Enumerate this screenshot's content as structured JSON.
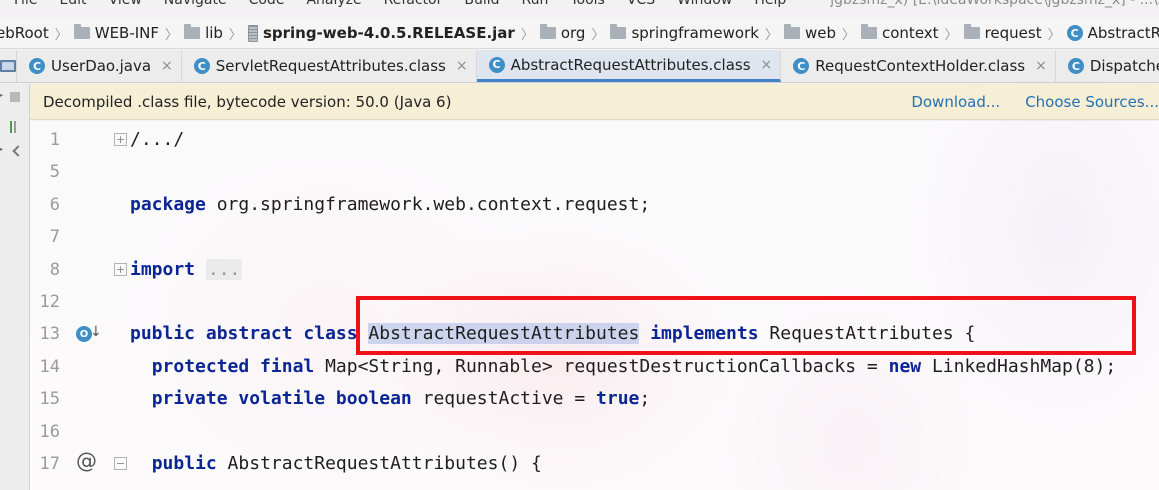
{
  "menubar": {
    "items": [
      "File",
      "Edit",
      "View",
      "Navigate",
      "Code",
      "Analyze",
      "Refactor",
      "Build",
      "Run",
      "Tools",
      "VCS",
      "Window",
      "Help"
    ],
    "project_path": "jgbzsmz_x) [E:\\ideaWorkspace\\jgbzsmz_x] - ...\\spring"
  },
  "breadcrumbs": [
    {
      "label": "ebRoot",
      "icon": "folder-icon",
      "bold": false
    },
    {
      "label": "WEB-INF",
      "icon": "folder-icon",
      "bold": false
    },
    {
      "label": "lib",
      "icon": "folder-icon",
      "bold": false
    },
    {
      "label": "spring-web-4.0.5.RELEASE.jar",
      "icon": "jar-icon",
      "bold": true
    },
    {
      "label": "org",
      "icon": "folder-icon",
      "bold": false
    },
    {
      "label": "springframework",
      "icon": "folder-icon",
      "bold": false
    },
    {
      "label": "web",
      "icon": "folder-icon",
      "bold": false
    },
    {
      "label": "context",
      "icon": "folder-icon",
      "bold": false
    },
    {
      "label": "request",
      "icon": "folder-icon",
      "bold": false
    },
    {
      "label": "AbstractRequestAttributes",
      "icon": "class-icon",
      "bold": false
    }
  ],
  "tabs": [
    {
      "label": "UserDao.java",
      "active": false
    },
    {
      "label": "ServletRequestAttributes.class",
      "active": false
    },
    {
      "label": "AbstractRequestAttributes.class",
      "active": true
    },
    {
      "label": "RequestContextHolder.class",
      "active": false
    },
    {
      "label": "Dispatcher",
      "active": false
    }
  ],
  "tab_close_glyph": "×",
  "class_icon_letter": "C",
  "banner": {
    "text": "Decompiled .class file, bytecode version: 50.0 (Java 6)",
    "download_label": "Download...",
    "sources_label": "Choose Sources..."
  },
  "code": {
    "lines": [
      {
        "num": "1",
        "text": "/.../",
        "kind": "fold-comment"
      },
      {
        "num": "5",
        "text": "",
        "kind": "plain"
      },
      {
        "num": "6",
        "kw": "package",
        "text": " org.springframework.web.context.request;",
        "kind": "package"
      },
      {
        "num": "7",
        "text": "",
        "kind": "plain"
      },
      {
        "num": "8",
        "kw": "import",
        "text": " ...",
        "kind": "import"
      },
      {
        "num": "12",
        "text": "",
        "kind": "plain"
      },
      {
        "num": "13",
        "kind": "class-decl",
        "kw1": "public abstract class",
        "name": "AbstractRequestAttributes",
        "kw2": "implements",
        "iface": "RequestAttributes {"
      },
      {
        "num": "14",
        "kind": "field",
        "kw": "protected final",
        "text": " Map<String, Runnable> requestDestructionCallbacks = ",
        "kw_end": "new",
        "tail": " LinkedHashMap(8);"
      },
      {
        "num": "15",
        "kind": "field",
        "kw": "private volatile boolean",
        "text": " requestActive = ",
        "kw_end": "true",
        "tail": ";"
      },
      {
        "num": "16",
        "text": "",
        "kind": "plain"
      },
      {
        "num": "17",
        "kind": "ctor",
        "kw": "public",
        "text": " AbstractRequestAttributes() {"
      }
    ]
  },
  "gutter": {
    "override_icon_letter": "O",
    "override_arrow": "↓",
    "annotation_glyph": "@"
  },
  "highlight_color": "#f0101a"
}
